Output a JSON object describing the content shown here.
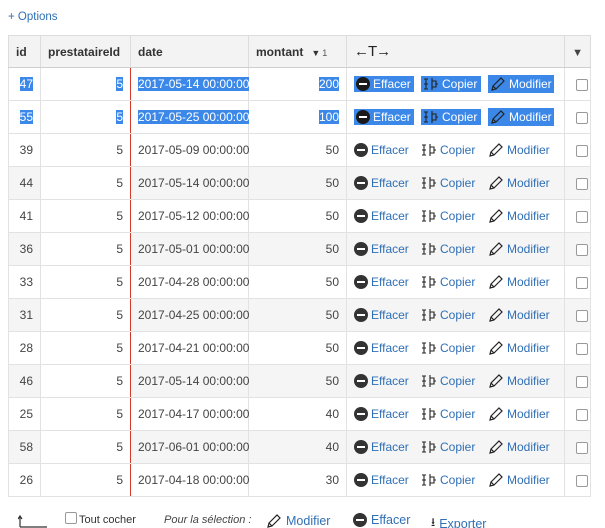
{
  "options_link": "+ Options",
  "columns": {
    "id": "id",
    "prestataire": "prestataireId",
    "date": "date",
    "montant": "montant",
    "sort_order": "1"
  },
  "action_labels": {
    "delete": "Effacer",
    "copy": "Copier",
    "edit": "Modifier"
  },
  "rows": [
    {
      "id": "47",
      "prestataire": "5",
      "date": "2017-05-14 00:00:00",
      "montant": "200",
      "selected": true
    },
    {
      "id": "55",
      "prestataire": "5",
      "date": "2017-05-25 00:00:00",
      "montant": "100",
      "selected": true
    },
    {
      "id": "39",
      "prestataire": "5",
      "date": "2017-05-09 00:00:00",
      "montant": "50"
    },
    {
      "id": "44",
      "prestataire": "5",
      "date": "2017-05-14 00:00:00",
      "montant": "50"
    },
    {
      "id": "41",
      "prestataire": "5",
      "date": "2017-05-12 00:00:00",
      "montant": "50"
    },
    {
      "id": "36",
      "prestataire": "5",
      "date": "2017-05-01 00:00:00",
      "montant": "50"
    },
    {
      "id": "33",
      "prestataire": "5",
      "date": "2017-04-28 00:00:00",
      "montant": "50"
    },
    {
      "id": "31",
      "prestataire": "5",
      "date": "2017-04-25 00:00:00",
      "montant": "50"
    },
    {
      "id": "28",
      "prestataire": "5",
      "date": "2017-04-21 00:00:00",
      "montant": "50"
    },
    {
      "id": "46",
      "prestataire": "5",
      "date": "2017-05-14 00:00:00",
      "montant": "50"
    },
    {
      "id": "25",
      "prestataire": "5",
      "date": "2017-04-17 00:00:00",
      "montant": "40"
    },
    {
      "id": "58",
      "prestataire": "5",
      "date": "2017-06-01 00:00:00",
      "montant": "40"
    },
    {
      "id": "26",
      "prestataire": "5",
      "date": "2017-04-18 00:00:00",
      "montant": "30"
    }
  ],
  "footer": {
    "check_all": "Tout cocher",
    "for_selection": "Pour la sélection :",
    "edit": "Modifier",
    "delete": "Effacer",
    "export": "Exporter"
  }
}
